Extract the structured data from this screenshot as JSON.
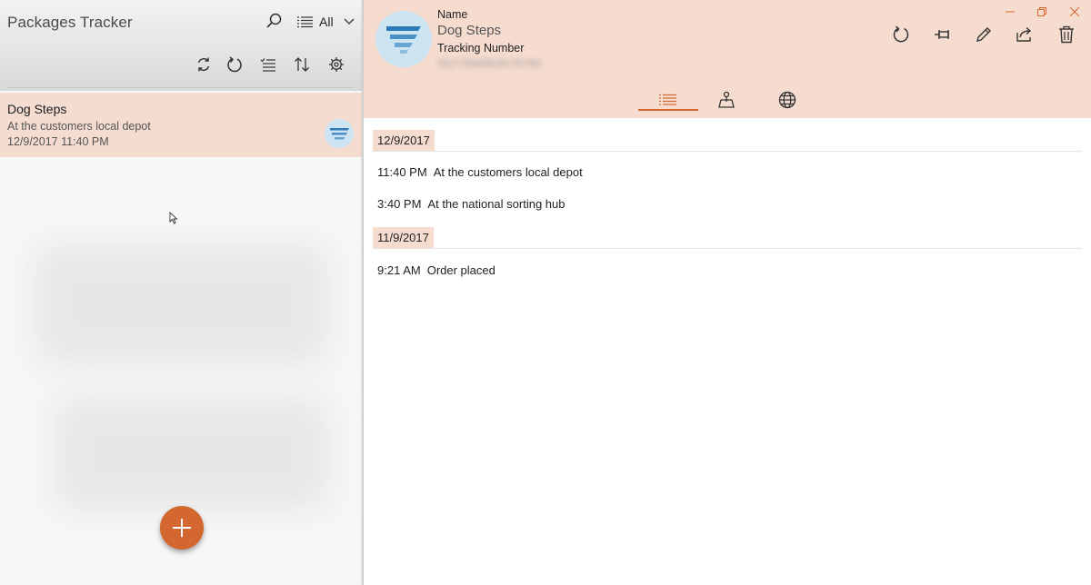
{
  "app": {
    "title": "Packages Tracker",
    "filter_label": "All",
    "accent_color": "#d4662f",
    "selection_color": "#f4dcd1",
    "header_color": "#f6dccf"
  },
  "toolbar_icons": [
    "search-icon",
    "filter-list-icon",
    "sync-icon",
    "refresh-icon",
    "select-list-icon",
    "sort-icon",
    "settings-icon"
  ],
  "packages": [
    {
      "name": "Dog Steps",
      "status": "At the customers local depot",
      "date": "12/9/2017 11:40 PM"
    }
  ],
  "detail": {
    "name_label": "Name",
    "name_value": "Dog Steps",
    "tracking_label": "Tracking Number",
    "tracking_value": "5527994963076790",
    "actions": [
      "refresh-icon",
      "pin-icon",
      "edit-icon",
      "share-icon",
      "delete-icon"
    ],
    "tabs": [
      "list-tab",
      "map-tab",
      "web-tab"
    ],
    "active_tab": 0,
    "groups": [
      {
        "date": "12/9/2017",
        "events": [
          {
            "time": "11:40 PM",
            "desc": "At the customers local depot"
          },
          {
            "time": "3:40 PM",
            "desc": "At the national sorting hub"
          }
        ]
      },
      {
        "date": "11/9/2017",
        "events": [
          {
            "time": "9:21 AM",
            "desc": "Order placed"
          }
        ]
      }
    ]
  }
}
